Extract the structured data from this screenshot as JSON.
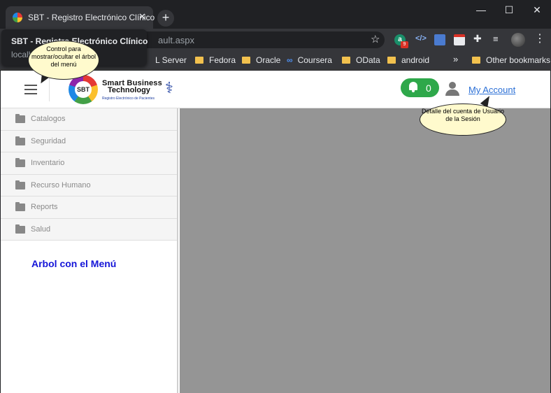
{
  "browser": {
    "tab_title": "SBT - Registro Electrónico Clínico",
    "tab_close": "✕",
    "new_tab": "+",
    "window_controls": {
      "minimize": "—",
      "maximize": "☐",
      "close": "✕"
    },
    "url_visible": "ault.aspx",
    "tooltip": {
      "title": "SBT - Registro Electrónico Clínico",
      "url": "localh"
    },
    "bookmarks": [
      {
        "label": "L Server",
        "icon": "none"
      },
      {
        "label": "Fedora",
        "icon": "folder-icon"
      },
      {
        "label": "Oracle",
        "icon": "folder-icon"
      },
      {
        "label": "Coursera",
        "icon": "coursera-icon"
      },
      {
        "label": "OData",
        "icon": "folder-icon"
      },
      {
        "label": "android",
        "icon": "folder-icon"
      }
    ],
    "bookmarks_overflow": "»",
    "other_bookmarks": "Other bookmarks",
    "extension_badge": "9"
  },
  "header": {
    "logo": {
      "badge_text": "SBT",
      "title_line1": "Smart Business",
      "title_line2": "Technology",
      "subtitle": "Registro Electrónico de Pacientes"
    },
    "notifications_count": "0",
    "my_account": "My Account",
    "colors": {
      "notif_bg": "#2ea84a",
      "link": "#2a6fd6"
    }
  },
  "sidebar": {
    "items": [
      {
        "label": "Catalogos"
      },
      {
        "label": "Seguridad"
      },
      {
        "label": "Inventario"
      },
      {
        "label": "Recurso Humano"
      },
      {
        "label": "Reports"
      },
      {
        "label": "Salud"
      }
    ],
    "caption": "Arbol con el Menú"
  },
  "callouts": {
    "menu_toggle": "Control para mostrar/ocultar el árbol del menú",
    "account": "Detalle del cuenta de Usuario de la Sesión"
  }
}
